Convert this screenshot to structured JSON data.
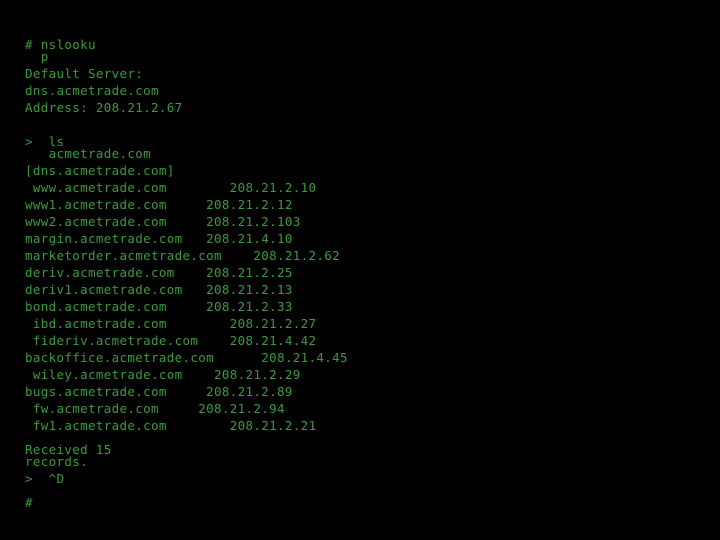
{
  "terminal": {
    "colors": {
      "background": "#000000",
      "foreground": "#3c9a3c"
    },
    "session": {
      "prompt_symbol": "#",
      "command_line": "# nslooku",
      "command_wrap": "  p",
      "default_server_label": "Default Server:",
      "server_name": "dns.acmetrade.com",
      "address_line": "Address: 208.21.2.67",
      "ls_command": ">  ls",
      "ls_wrap": "   acmetrade.com",
      "zone_header": "[dns.acmetrade.com]",
      "received_line": "Received 15",
      "received_wrap": "records.",
      "eof_line": ">  ^D",
      "final_prompt": "#"
    },
    "records": [
      {
        "host": " www.acmetrade.com",
        "ip": "        208.21.2.10"
      },
      {
        "host": "www1.acmetrade.com",
        "ip": "     208.21.2.12"
      },
      {
        "host": "www2.acmetrade.com",
        "ip": "     208.21.2.103"
      },
      {
        "host": "margin.acmetrade.com",
        "ip": "   208.21.4.10"
      },
      {
        "host": "marketorder.acmetrade.com",
        "ip": "    208.21.2.62"
      },
      {
        "host": "deriv.acmetrade.com",
        "ip": "    208.21.2.25"
      },
      {
        "host": "deriv1.acmetrade.com",
        "ip": "   208.21.2.13"
      },
      {
        "host": "bond.acmetrade.com",
        "ip": "     208.21.2.33"
      },
      {
        "host": " ibd.acmetrade.com",
        "ip": "        208.21.2.27"
      },
      {
        "host": " fideriv.acmetrade.com",
        "ip": "    208.21.4.42"
      },
      {
        "host": "backoffice.acmetrade.com",
        "ip": "      208.21.4.45"
      },
      {
        "host": " wiley.acmetrade.com",
        "ip": "    208.21.2.29"
      },
      {
        "host": "bugs.acmetrade.com",
        "ip": "     208.21.2.89"
      },
      {
        "host": " fw.acmetrade.com",
        "ip": "     208.21.2.94"
      },
      {
        "host": " fw1.acmetrade.com",
        "ip": "        208.21.2.21"
      }
    ]
  }
}
